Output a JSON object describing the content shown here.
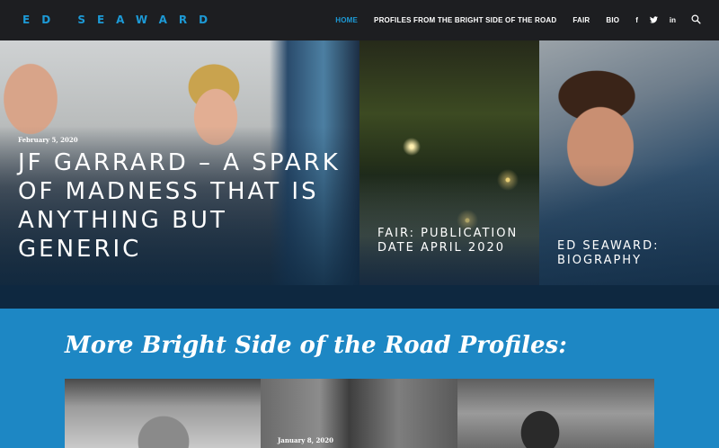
{
  "header": {
    "logo": "ED SEAWARD",
    "nav": [
      {
        "label": "HOME",
        "active": true
      },
      {
        "label": "PROFILES FROM THE BRIGHT SIDE OF THE ROAD",
        "active": false
      },
      {
        "label": "FAIR",
        "active": false
      },
      {
        "label": "BIO",
        "active": false
      }
    ],
    "social": [
      {
        "icon": "facebook-icon",
        "glyph": "f"
      },
      {
        "icon": "twitter-icon",
        "glyph": "t"
      },
      {
        "icon": "linkedin-icon",
        "glyph": "in"
      }
    ],
    "search_icon": "search-icon"
  },
  "hero": {
    "main": {
      "date": "February 5, 2020",
      "title": "JF GARRARD – A SPARK OF MADNESS THAT IS ANYTHING BUT GENERIC"
    },
    "tile2": {
      "title": "FAIR: PUBLICATION DATE APRIL 2020"
    },
    "tile3": {
      "title": "ED SEAWARD: BIOGRAPHY"
    }
  },
  "section": {
    "title": "More Bright Side of the Road Profiles:",
    "profiles": [
      {
        "date": ""
      },
      {
        "date": "January 8, 2020"
      },
      {
        "date": ""
      }
    ]
  },
  "colors": {
    "accent": "#1d9ad6",
    "header_bg": "#1d1e21",
    "hero_overlay": "#0e2840",
    "section_bg": "#1d87c4"
  }
}
